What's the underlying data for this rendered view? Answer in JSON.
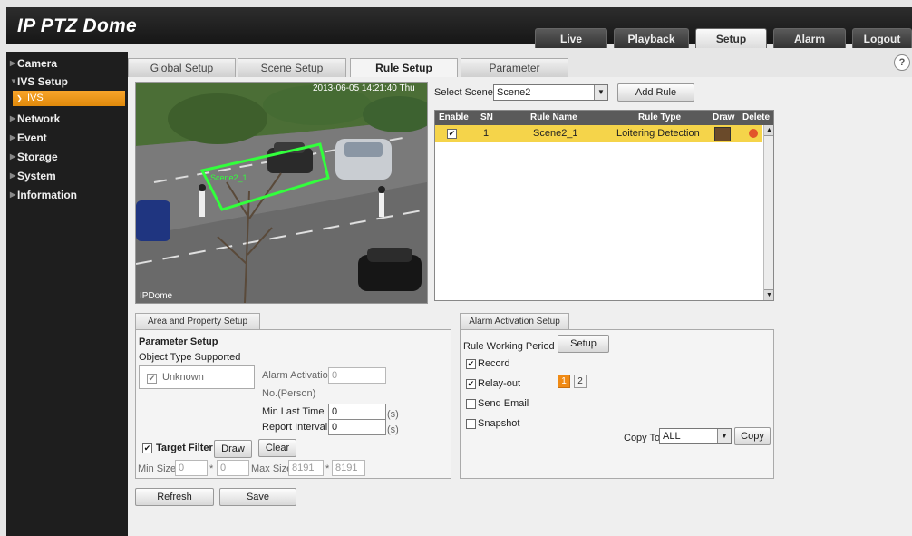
{
  "app": {
    "title": "IP PTZ Dome"
  },
  "topnav": [
    {
      "label": "Live"
    },
    {
      "label": "Playback"
    },
    {
      "label": "Setup"
    },
    {
      "label": "Alarm"
    },
    {
      "label": "Logout"
    }
  ],
  "sidebar": [
    {
      "label": "Camera"
    },
    {
      "label": "IVS Setup"
    },
    {
      "label": "IVS"
    },
    {
      "label": "Network"
    },
    {
      "label": "Event"
    },
    {
      "label": "Storage"
    },
    {
      "label": "System"
    },
    {
      "label": "Information"
    }
  ],
  "tabs": [
    {
      "label": "Global Setup"
    },
    {
      "label": "Scene Setup"
    },
    {
      "label": "Rule Setup"
    },
    {
      "label": "Parameter"
    }
  ],
  "help": {
    "icon": "?"
  },
  "video": {
    "timestamp": "2013-06-05 14:21:40 Thu",
    "camera_name": "IPDome",
    "rule_label": "Scene2_1"
  },
  "scene": {
    "label": "Select Scene",
    "value": "Scene2",
    "add_rule_label": "Add Rule"
  },
  "rules_table": {
    "headers": [
      "Enable",
      "SN",
      "Rule Name",
      "Rule Type",
      "Draw",
      "Delete"
    ],
    "rows": [
      {
        "enabled": "✔",
        "sn": "1",
        "name": "Scene2_1",
        "type": "Loitering Detection"
      }
    ]
  },
  "area_setup": {
    "tab_label": "Area and Property Setup",
    "param_title": "Parameter Setup",
    "object_type_label": "Object Type Supported",
    "object_type_value": "Unknown",
    "object_checked": "✔",
    "alarm_activation_label": "Alarm Activation",
    "alarm_activation_value": "0",
    "no_person_label": "No.(Person)",
    "min_last_time_label": "Min Last Time",
    "min_last_time_value": "0",
    "report_interval_label": "Report Interval",
    "report_interval_value": "0",
    "unit": "(s)",
    "target_filter_label": "Target Filter",
    "target_filter_checked": "✔",
    "draw_label": "Draw",
    "clear_label": "Clear",
    "min_size_label": "Min Size",
    "min_w": "0",
    "min_h": "0",
    "max_size_label": "Max Size",
    "max_w": "8191",
    "max_h": "8191",
    "sep": "*"
  },
  "alarm_setup": {
    "tab_label": "Alarm Activation Setup",
    "working_period_label": "Rule Working Period",
    "setup_label": "Setup",
    "record_label": "Record",
    "record_checked": "✔",
    "relay_label": "Relay-out",
    "relay_checked": "✔",
    "relay_channels": [
      "1",
      "2"
    ],
    "send_email_label": "Send Email",
    "snapshot_label": "Snapshot",
    "copy_to_label": "Copy To",
    "copy_to_value": "ALL",
    "copy_label": "Copy"
  },
  "footer": {
    "refresh_label": "Refresh",
    "save_label": "Save"
  },
  "colors": {
    "accent": "#f19614",
    "topbar": "#1e1e1e",
    "row_highlight": "#f5d44a",
    "rule_box": "#32ff3c"
  }
}
